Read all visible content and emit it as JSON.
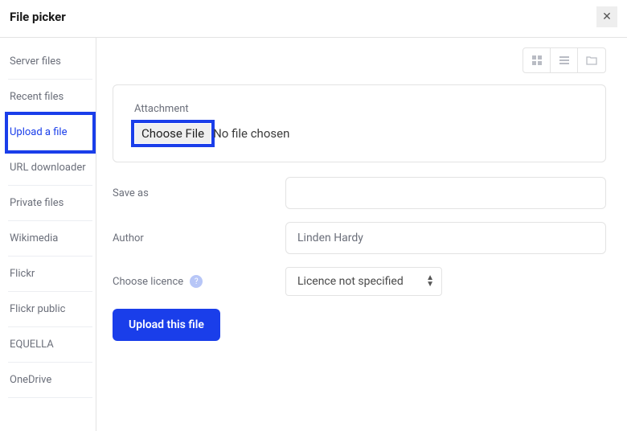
{
  "header": {
    "title": "File picker"
  },
  "sidebar": {
    "items": [
      {
        "label": "Server files"
      },
      {
        "label": "Recent files"
      },
      {
        "label": "Upload a file"
      },
      {
        "label": "URL downloader"
      },
      {
        "label": "Private files"
      },
      {
        "label": "Wikimedia"
      },
      {
        "label": "Flickr"
      },
      {
        "label": "Flickr public"
      },
      {
        "label": "EQUELLA"
      },
      {
        "label": "OneDrive"
      }
    ]
  },
  "attachment": {
    "label": "Attachment",
    "choose_label": "Choose File",
    "status": "No file chosen"
  },
  "form": {
    "saveas_label": "Save as",
    "saveas_value": "",
    "author_label": "Author",
    "author_value": "Linden Hardy",
    "licence_label": "Choose licence",
    "licence_value": "Licence not specified",
    "upload_label": "Upload this file"
  }
}
